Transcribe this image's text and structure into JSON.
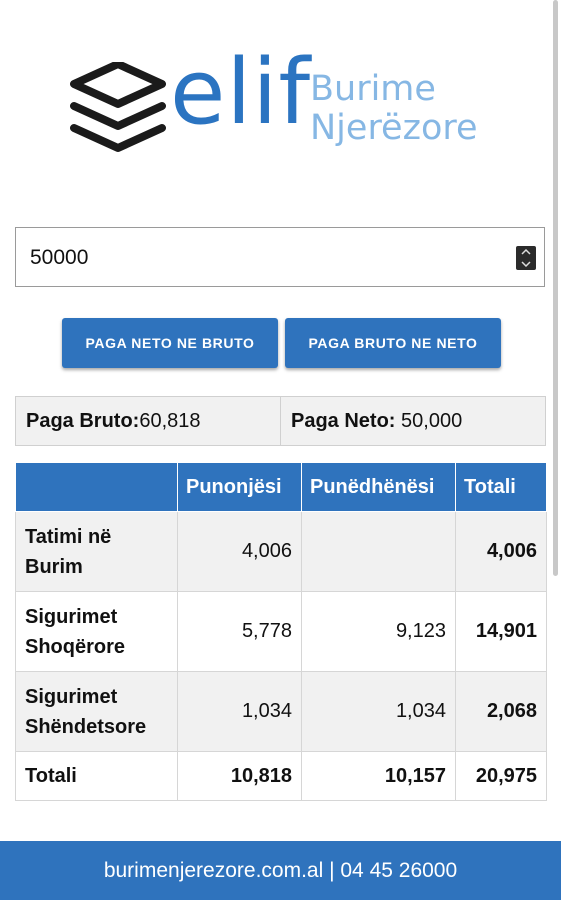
{
  "logo": {
    "word": "elif",
    "sub_line1": "Burime",
    "sub_line2": "Njerëzore",
    "icon": "stacked-layers-icon"
  },
  "amount_input": {
    "value": "50000"
  },
  "buttons": {
    "net_to_gross": "PAGA NETO NE BRUTO",
    "gross_to_net": "PAGA BRUTO NE NETO"
  },
  "summary": {
    "gross_label": "Paga Bruto:",
    "gross_value": "60,818",
    "net_label": "Paga Neto:",
    "net_value": "50,000"
  },
  "table": {
    "headers": [
      "",
      "Punonjësi",
      "Punëdhënësi",
      "Totali"
    ],
    "rows": [
      {
        "name_l1": "Tatimi në",
        "name_l2": "Burim",
        "employee": "4,006",
        "employer": "",
        "total": "4,006"
      },
      {
        "name_l1": "Sigurimet",
        "name_l2": "Shoqërore",
        "employee": "5,778",
        "employer": "9,123",
        "total": "14,901"
      },
      {
        "name_l1": "Sigurimet",
        "name_l2": "Shëndetsore",
        "employee": "1,034",
        "employer": "1,034",
        "total": "2,068"
      }
    ],
    "totals": {
      "label": "Totali",
      "employee": "10,818",
      "employer": "10,157",
      "total": "20,975"
    }
  },
  "footer": {
    "text": "burimenjerezore.com.al | 04 45 26000"
  },
  "colors": {
    "accent": "#2f73bd",
    "logo_dark": "#2b74c1",
    "logo_light": "#86b7e4"
  }
}
